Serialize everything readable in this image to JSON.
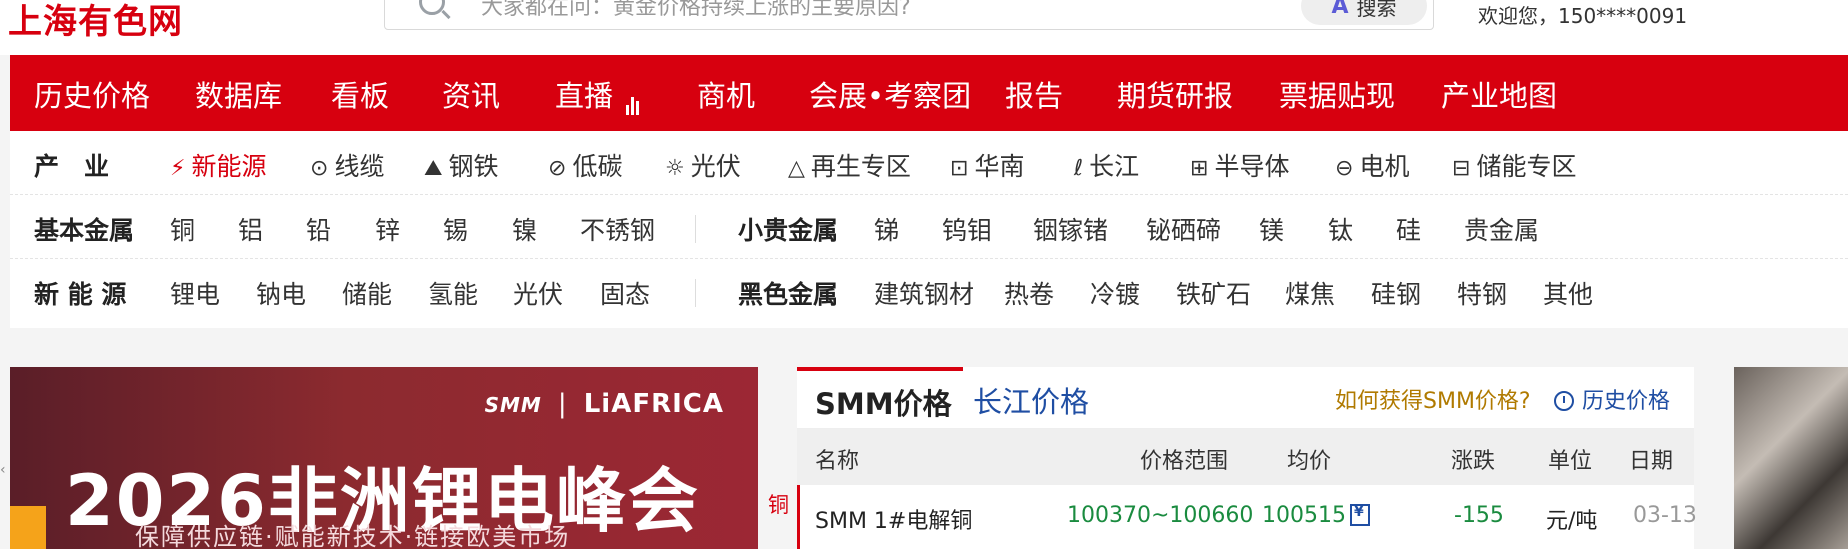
{
  "header": {
    "logo_text": "上海有色网",
    "search_placeholder": "大家都在问：黄金价格持续上涨的主要原因?",
    "search_button": "搜索",
    "search_ai_icon": "ai-icon",
    "welcome_text": "欢迎您，150****0091"
  },
  "nav": {
    "items": [
      "历史价格",
      "数据库",
      "看板",
      "资讯",
      "直播",
      "商机",
      "会展•考察团",
      "报告",
      "期货研报",
      "票据贴现",
      "产业地图"
    ]
  },
  "categories": {
    "row1": {
      "title": "产　业",
      "items": [
        {
          "label": "新能源",
          "icon": "battery-icon",
          "glyph": "⚡"
        },
        {
          "label": "线缆",
          "icon": "cable-icon",
          "glyph": "⊙"
        },
        {
          "label": "钢铁",
          "icon": "steel-icon",
          "glyph": "⛰"
        },
        {
          "label": "低碳",
          "icon": "leaf-icon",
          "glyph": "⊘"
        },
        {
          "label": "光伏",
          "icon": "sun-icon",
          "glyph": "☼"
        },
        {
          "label": "再生专区",
          "icon": "recycle-icon",
          "glyph": "△"
        },
        {
          "label": "华南",
          "icon": "map-icon",
          "glyph": "⊡"
        },
        {
          "label": "长江",
          "icon": "river-icon",
          "glyph": "ℓ"
        },
        {
          "label": "半导体",
          "icon": "chip-icon",
          "glyph": "⊞"
        },
        {
          "label": "电机",
          "icon": "motor-icon",
          "glyph": "⊖"
        },
        {
          "label": "储能专区",
          "icon": "storage-icon",
          "glyph": "⊟"
        }
      ]
    },
    "row2": {
      "title": "基本金属",
      "items": [
        "铜",
        "铝",
        "铅",
        "锌",
        "锡",
        "镍",
        "不锈钢"
      ],
      "title2": "小贵金属",
      "items2": [
        "锑",
        "钨钼",
        "铟镓锗",
        "铋硒碲",
        "镁",
        "钛",
        "硅",
        "贵金属"
      ]
    },
    "row3": {
      "title": "新 能 源",
      "items": [
        "锂电",
        "钠电",
        "储能",
        "氢能",
        "光伏",
        "固态"
      ],
      "title2": "黑色金属",
      "items2": [
        "建筑钢材",
        "热卷",
        "冷镀",
        "铁矿石",
        "煤焦",
        "硅钢",
        "特钢",
        "其他"
      ]
    }
  },
  "banner": {
    "brand_smm": "SMM",
    "brand_name": "LiAFRICA",
    "headline": "2026非洲锂电峰会",
    "subline": "保障供应链·赋能新技术·链接欧美市场"
  },
  "prices": {
    "tab_smm": "SMM价格",
    "tab_changjiang": "长江价格",
    "how_link": "如何获得SMM价格?",
    "history_link": "历史价格",
    "columns": [
      "名称",
      "价格范围",
      "均价",
      "涨跌",
      "单位",
      "日期"
    ],
    "metal_label": "铜",
    "rows": [
      {
        "name": "SMM 1#电解铜",
        "range": "100370~100660",
        "avg": "100515",
        "change": "-155",
        "unit": "元/吨",
        "date": "03-13"
      }
    ]
  },
  "colors": {
    "brand_red": "#d7000f",
    "link_blue": "#1f4ea3",
    "down_green": "#1a8b3f"
  }
}
